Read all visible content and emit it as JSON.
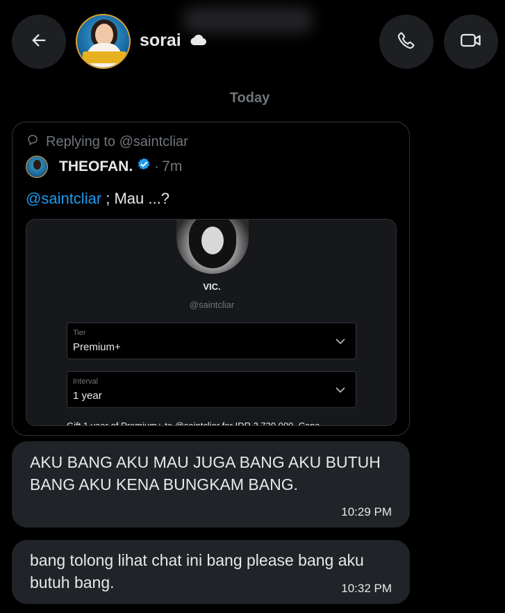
{
  "header": {
    "username": "sorai",
    "back_icon": "arrow-left-icon",
    "call_icon": "phone-icon",
    "video_icon": "video-camera-icon",
    "status_icon": "cloud-icon"
  },
  "chat": {
    "date_separator": "Today",
    "shared_post": {
      "replying_to": "Replying to @saintcliar",
      "author": "THEOFAN.",
      "separator": "·",
      "time_ago": "7m",
      "mention": "@saintcliar",
      "text": " ; Mau ...?",
      "embed": {
        "name": "VIC.",
        "handle": "@saintcliar",
        "tier_label": "Tier",
        "tier_value": "Premium+",
        "interval_label": "Interval",
        "interval_value": "1 year",
        "footer_text": "Gift 1 year of Premium+ to @saintcliar for IDR 3.720.000. Conc"
      }
    },
    "messages": [
      {
        "text": "AKU BANG AKU MAU JUGA BANG AKU BUTUH BANG AKU KENA BUNGKAM BANG.",
        "time": "10:29 PM"
      },
      {
        "text": "bang tolong lihat chat ini bang please bang aku butuh bang.",
        "time": "10:32 PM"
      }
    ]
  },
  "colors": {
    "background": "#000000",
    "bubble": "#202327",
    "accent": "#1d9bf0",
    "muted": "#71767b"
  }
}
